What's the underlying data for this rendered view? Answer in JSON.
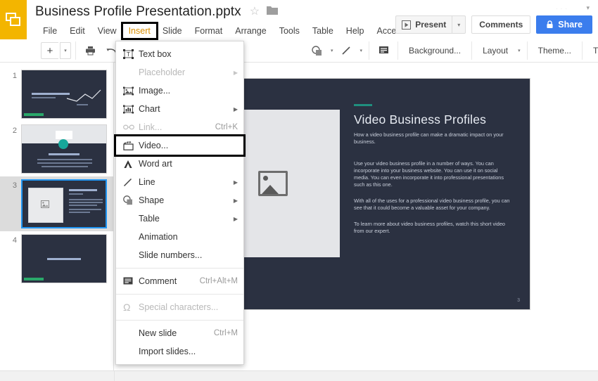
{
  "app": {
    "logo_icon": "slides-logo-icon",
    "doc_title": "Business Profile Presentation.pptx",
    "star_icon": "☆",
    "folder_icon": "folder-icon",
    "chevron_icon": "▾"
  },
  "menubar": {
    "items": [
      {
        "label": "File",
        "active": false
      },
      {
        "label": "Edit",
        "active": false
      },
      {
        "label": "View",
        "active": false
      },
      {
        "label": "Insert",
        "active": true
      },
      {
        "label": "Slide",
        "active": false
      },
      {
        "label": "Format",
        "active": false
      },
      {
        "label": "Arrange",
        "active": false
      },
      {
        "label": "Tools",
        "active": false
      },
      {
        "label": "Table",
        "active": false
      },
      {
        "label": "Help",
        "active": false
      },
      {
        "label": "Accessib",
        "active": false
      }
    ]
  },
  "header_actions": {
    "present_label": "Present",
    "present_caret": "▾",
    "comments_label": "Comments",
    "share_label": "Share",
    "share_icon": "lock-icon",
    "share_color": "#3b7ded"
  },
  "toolbar": {
    "new_slide_icon": "+",
    "new_slide_caret": "▾",
    "print_icon": "print-icon",
    "undo_icon": "undo-icon",
    "redo_icon": "redo-icon",
    "shape_icon": "shape-icon",
    "shape_caret": "▾",
    "line_icon": "line-icon",
    "line_caret": "▾",
    "comment_icon": "comment-icon",
    "background_label": "Background...",
    "layout_label": "Layout",
    "layout_caret": "▾",
    "theme_label": "Theme...",
    "transition_label": "Transition...",
    "collapse_icon": "chevron-up-icon"
  },
  "insert_menu": {
    "items": [
      {
        "label": "Text box",
        "icon": "textbox-icon",
        "shortcut": "",
        "arrow": false,
        "disabled": false,
        "highlighted": false,
        "separator_after": false
      },
      {
        "label": "Placeholder",
        "icon": "",
        "shortcut": "",
        "arrow": true,
        "disabled": true,
        "highlighted": false,
        "separator_after": false
      },
      {
        "label": "Image...",
        "icon": "image-icon",
        "shortcut": "",
        "arrow": false,
        "disabled": false,
        "highlighted": false,
        "separator_after": false
      },
      {
        "label": "Chart",
        "icon": "chart-icon",
        "shortcut": "",
        "arrow": true,
        "disabled": false,
        "highlighted": false,
        "separator_after": false
      },
      {
        "label": "Link...",
        "icon": "link-icon",
        "shortcut": "Ctrl+K",
        "arrow": false,
        "disabled": true,
        "highlighted": false,
        "separator_after": false
      },
      {
        "label": "Video...",
        "icon": "video-icon",
        "shortcut": "",
        "arrow": false,
        "disabled": false,
        "highlighted": true,
        "separator_after": false
      },
      {
        "label": "Word art",
        "icon": "wordart-icon",
        "shortcut": "",
        "arrow": false,
        "disabled": false,
        "highlighted": false,
        "separator_after": false
      },
      {
        "label": "Line",
        "icon": "line-icon",
        "shortcut": "",
        "arrow": true,
        "disabled": false,
        "highlighted": false,
        "separator_after": false
      },
      {
        "label": "Shape",
        "icon": "shape-icon",
        "shortcut": "",
        "arrow": true,
        "disabled": false,
        "highlighted": false,
        "separator_after": false
      },
      {
        "label": "Table",
        "icon": "",
        "shortcut": "",
        "arrow": true,
        "disabled": false,
        "highlighted": false,
        "separator_after": false
      },
      {
        "label": "Animation",
        "icon": "",
        "shortcut": "",
        "arrow": false,
        "disabled": false,
        "highlighted": false,
        "separator_after": false
      },
      {
        "label": "Slide numbers...",
        "icon": "",
        "shortcut": "",
        "arrow": false,
        "disabled": false,
        "highlighted": false,
        "separator_after": true
      },
      {
        "label": "Comment",
        "icon": "comment-icon",
        "shortcut": "Ctrl+Alt+M",
        "arrow": false,
        "disabled": false,
        "highlighted": false,
        "separator_after": true
      },
      {
        "label": "Special characters...",
        "icon": "omega-icon",
        "shortcut": "",
        "arrow": false,
        "disabled": true,
        "highlighted": false,
        "separator_after": true
      },
      {
        "label": "New slide",
        "icon": "",
        "shortcut": "Ctrl+M",
        "arrow": false,
        "disabled": false,
        "highlighted": false,
        "separator_after": false
      },
      {
        "label": "Import slides...",
        "icon": "",
        "shortcut": "",
        "arrow": false,
        "disabled": false,
        "highlighted": false,
        "separator_after": false
      }
    ]
  },
  "filmstrip": {
    "slides": [
      {
        "number": "1",
        "selected": false,
        "kind": "title"
      },
      {
        "number": "2",
        "selected": false,
        "kind": "about"
      },
      {
        "number": "3",
        "selected": true,
        "kind": "video"
      },
      {
        "number": "4",
        "selected": false,
        "kind": "thanks"
      }
    ]
  },
  "slide": {
    "background_color": "#2b3141",
    "accent_color": "#1f8f7e",
    "image_placeholder_icon": "image-placeholder-icon",
    "title": "Video Business Profiles",
    "subtitle": "How a  video business profile can make a dramatic impact on your business.",
    "paragraphs": [
      "Use your video business profile in a number of ways. You can incorporate into your business website. You can use it on social media. You can even incorporate it into professional presentations such as this one.",
      "With all of the uses for a professional video business profile, you can see that it could become a valuable asset for your company.",
      "To learn more about video business profiles, watch this short video from our expert."
    ],
    "slide_number": "3"
  }
}
